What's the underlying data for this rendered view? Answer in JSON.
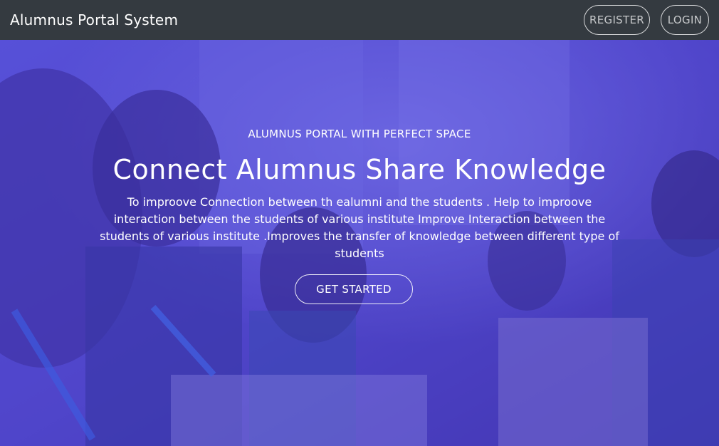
{
  "navbar": {
    "brand": "Alumnus Portal System",
    "register_label": "REGISTER",
    "login_label": "LOGIN"
  },
  "hero": {
    "subtitle": "ALUMNUS PORTAL WITH PERFECT SPACE",
    "title": "Connect Alumnus Share Knowledge",
    "description": "To improove Connection between th ealumni and the students . Help to improove interaction between the students of various institute Improve Interaction between the students of various institute .Improves the transfer of knowledge between different type of students",
    "cta_label": "GET STARTED"
  },
  "colors": {
    "navbar_bg": "#343a40",
    "hero_tint": "#5a4fc8",
    "text": "#ffffff"
  }
}
